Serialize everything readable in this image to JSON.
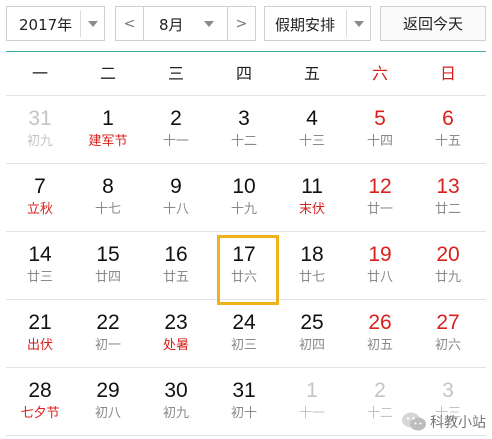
{
  "toolbar": {
    "year_value": "2017年",
    "month_value": "8月",
    "prev_label": "<",
    "next_label": ">",
    "holiday_value": "假期安排",
    "today_label": "返回今天"
  },
  "weekdays": [
    "一",
    "二",
    "三",
    "四",
    "五",
    "六",
    "日"
  ],
  "calendar": {
    "selected_day": 17,
    "rows": [
      [
        {
          "day": "31",
          "lunar": "初九",
          "state": "other"
        },
        {
          "day": "1",
          "lunar": "建军节",
          "festival": true
        },
        {
          "day": "2",
          "lunar": "十一"
        },
        {
          "day": "3",
          "lunar": "十二"
        },
        {
          "day": "4",
          "lunar": "十三"
        },
        {
          "day": "5",
          "lunar": "十四",
          "weekend": true
        },
        {
          "day": "6",
          "lunar": "十五",
          "weekend": true
        }
      ],
      [
        {
          "day": "7",
          "lunar": "立秋",
          "festival": true
        },
        {
          "day": "8",
          "lunar": "十七"
        },
        {
          "day": "9",
          "lunar": "十八"
        },
        {
          "day": "10",
          "lunar": "十九"
        },
        {
          "day": "11",
          "lunar": "末伏",
          "festival": true
        },
        {
          "day": "12",
          "lunar": "廿一",
          "weekend": true
        },
        {
          "day": "13",
          "lunar": "廿二",
          "weekend": true
        }
      ],
      [
        {
          "day": "14",
          "lunar": "廿三"
        },
        {
          "day": "15",
          "lunar": "廿四"
        },
        {
          "day": "16",
          "lunar": "廿五"
        },
        {
          "day": "17",
          "lunar": "廿六",
          "selected": true
        },
        {
          "day": "18",
          "lunar": "廿七"
        },
        {
          "day": "19",
          "lunar": "廿八",
          "weekend": true
        },
        {
          "day": "20",
          "lunar": "廿九",
          "weekend": true
        }
      ],
      [
        {
          "day": "21",
          "lunar": "出伏",
          "festival": true
        },
        {
          "day": "22",
          "lunar": "初一"
        },
        {
          "day": "23",
          "lunar": "处暑",
          "festival": true
        },
        {
          "day": "24",
          "lunar": "初三"
        },
        {
          "day": "25",
          "lunar": "初四"
        },
        {
          "day": "26",
          "lunar": "初五",
          "weekend": true
        },
        {
          "day": "27",
          "lunar": "初六",
          "weekend": true
        }
      ],
      [
        {
          "day": "28",
          "lunar": "七夕节",
          "festival": true
        },
        {
          "day": "29",
          "lunar": "初八"
        },
        {
          "day": "30",
          "lunar": "初九"
        },
        {
          "day": "31",
          "lunar": "初十"
        },
        {
          "day": "1",
          "lunar": "十一",
          "state": "other"
        },
        {
          "day": "2",
          "lunar": "十二",
          "state": "other"
        },
        {
          "day": "3",
          "lunar": "十三",
          "state": "other"
        }
      ]
    ]
  },
  "watermark": {
    "text": "科教小站",
    "icon": "wechat-icon"
  },
  "colors": {
    "accent_line": "#3bb0a3",
    "weekend_red": "#d9201b",
    "selected_border": "#f0b21a",
    "muted_gray": "#c4c4c4"
  }
}
